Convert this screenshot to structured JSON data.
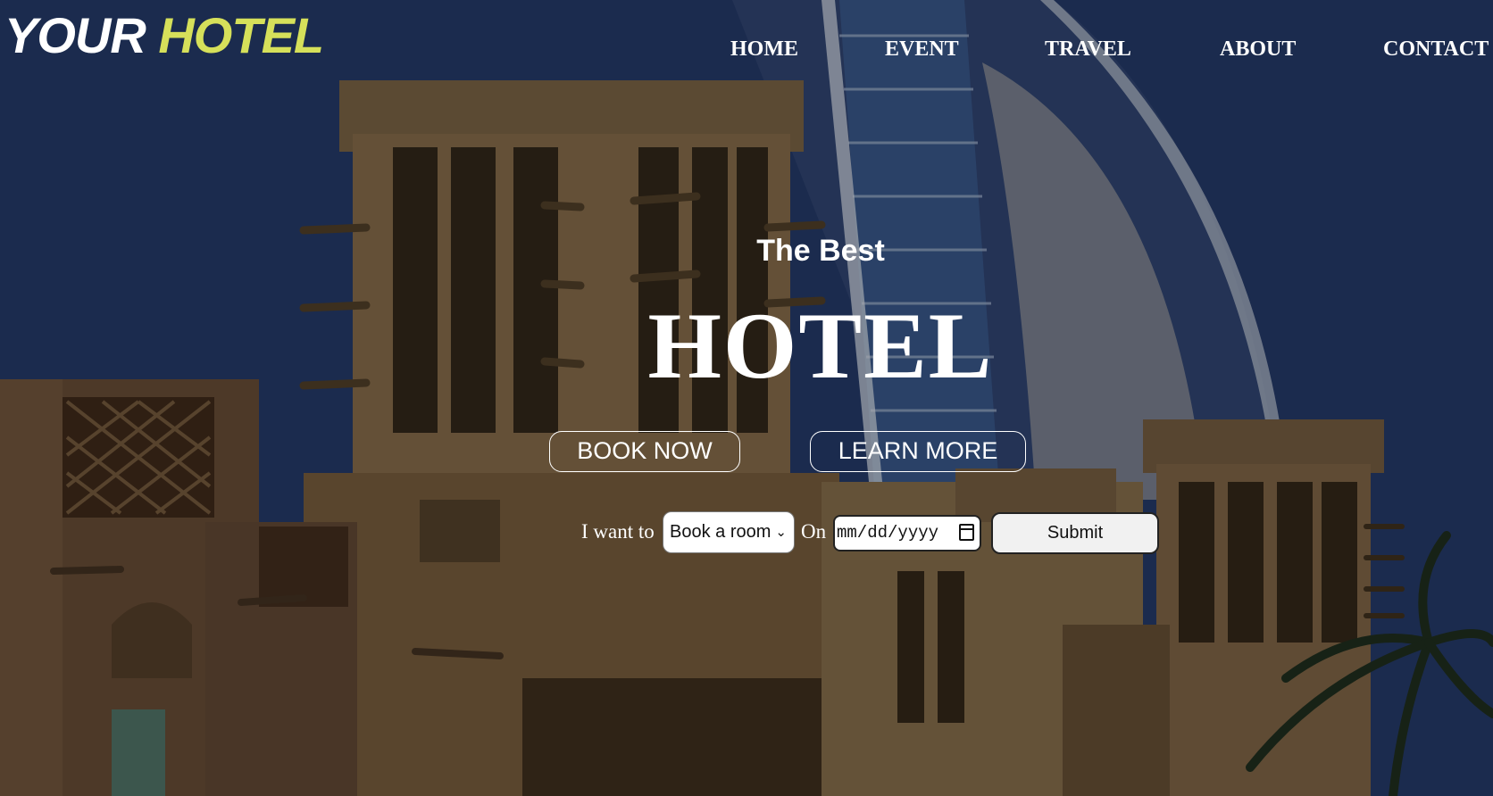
{
  "brand": {
    "primary": "YOUR",
    "accent": "HOTEL",
    "accent_color": "#d6e05a"
  },
  "nav": {
    "items": [
      {
        "label": "HOME"
      },
      {
        "label": "EVENT"
      },
      {
        "label": "TRAVEL"
      },
      {
        "label": "ABOUT"
      },
      {
        "label": "CONTACT"
      }
    ]
  },
  "hero": {
    "subtitle": "The Best",
    "headline": "HOTEL",
    "book_label": "BOOK NOW",
    "learn_label": "LEARN MORE"
  },
  "booking": {
    "want_label": "I want to",
    "select_value": "Book a room",
    "on_label": "On",
    "date_placeholder": "mm/dd/yyyy",
    "submit_label": "Submit"
  }
}
